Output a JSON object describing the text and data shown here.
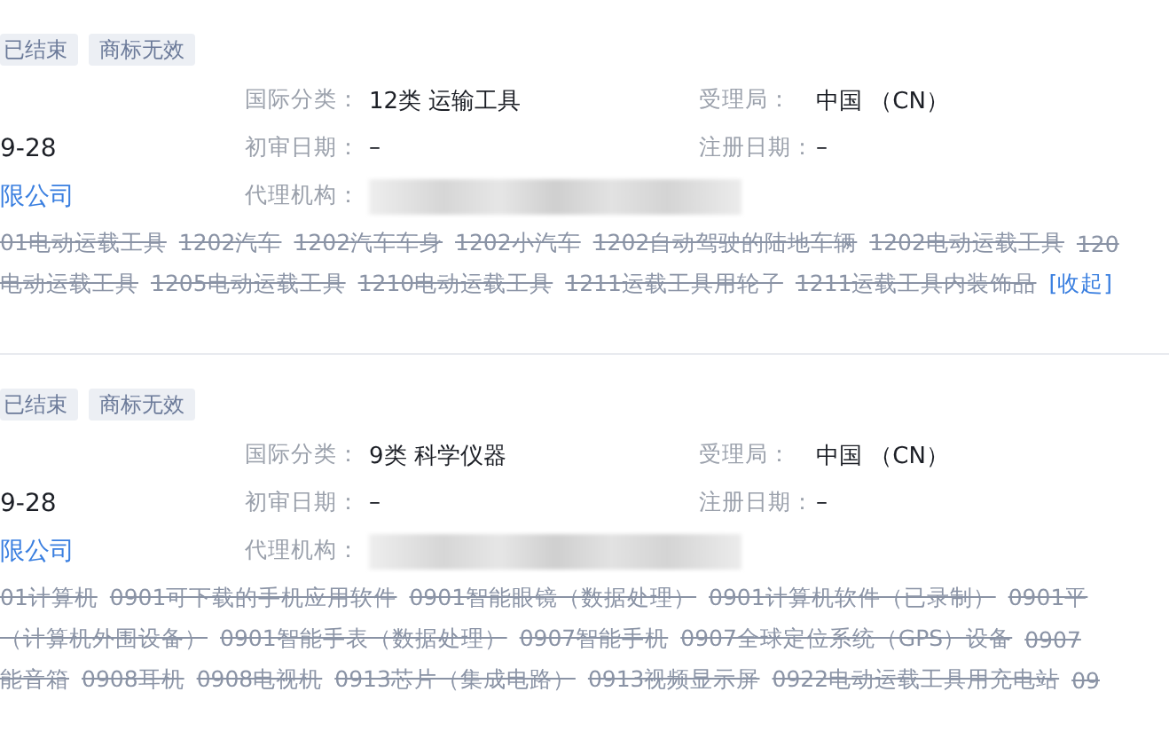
{
  "cards": [
    {
      "tags": [
        {
          "label": "已结束"
        },
        {
          "label": "商标无效"
        }
      ],
      "date": "9-28",
      "company": "限公司",
      "classification": {
        "label": "国际分类：",
        "value": "12类 运输工具"
      },
      "office": {
        "label": "受理局：",
        "value": "中国 （CN）"
      },
      "review_date": {
        "label": "初审日期：",
        "value": "–"
      },
      "registration_date": {
        "label": "注册日期：",
        "value": "–"
      },
      "agency": {
        "label": "代理机构：",
        "redacted": true
      },
      "goods_lines": [
        [
          "01电动运载工具",
          "1202汽车",
          "1202汽车车身",
          "1202小汽车",
          "1202自动驾驶的陆地车辆",
          "1202电动运载工具",
          "120"
        ],
        [
          "电动运载工具",
          "1205电动运载工具",
          "1210电动运载工具",
          "1211运载工具用轮子",
          "1211运载工具内装饰品"
        ]
      ],
      "collapse_link": "[收起]"
    },
    {
      "tags": [
        {
          "label": "已结束"
        },
        {
          "label": "商标无效"
        }
      ],
      "date": "9-28",
      "company": "限公司",
      "classification": {
        "label": "国际分类：",
        "value": "9类 科学仪器"
      },
      "office": {
        "label": "受理局：",
        "value": "中国 （CN）"
      },
      "review_date": {
        "label": "初审日期：",
        "value": "–"
      },
      "registration_date": {
        "label": "注册日期：",
        "value": "–"
      },
      "agency": {
        "label": "代理机构：",
        "redacted": true
      },
      "goods_lines": [
        [
          "01计算机",
          "0901可下载的手机应用软件",
          "0901智能眼镜（数据处理）",
          "0901计算机软件（已录制）",
          "0901平"
        ],
        [
          "（计算机外围设备）",
          "0901智能手表（数据处理）",
          "0907智能手机",
          "0907全球定位系统（GPS）设备",
          "0907"
        ],
        [
          "能音箱",
          "0908耳机",
          "0908电视机",
          "0913芯片（集成电路）",
          "0913视频显示屏",
          "0922电动运载工具用充电站",
          "09"
        ]
      ]
    }
  ]
}
